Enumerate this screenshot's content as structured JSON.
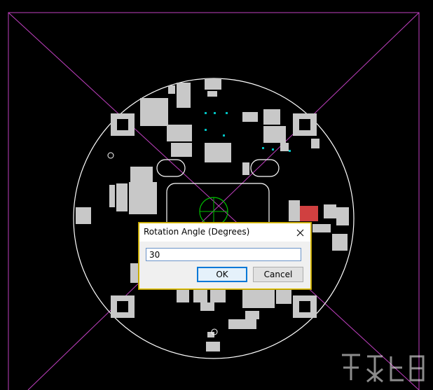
{
  "dialog": {
    "title": "Rotation Angle (Degrees)",
    "input_value": "30",
    "ok_label": "OK",
    "cancel_label": "Cancel",
    "close_icon": "close-icon"
  },
  "colors": {
    "background": "#000000",
    "board_outline": "#ffffff",
    "guide_lines": "#c040c0",
    "pad": "#c8c8c8",
    "ok_button_border": "#0078d7",
    "dialog_border": "#e2c200"
  }
}
